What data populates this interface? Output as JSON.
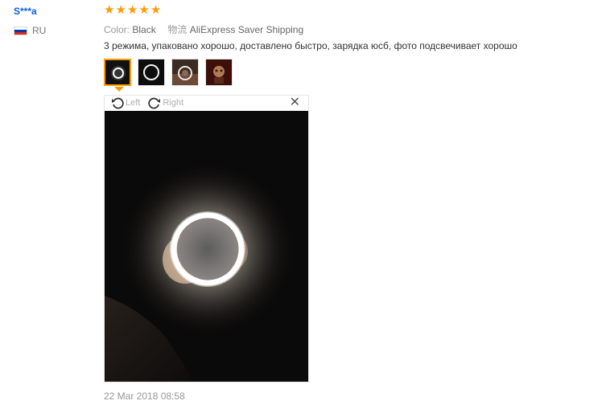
{
  "reviewer": {
    "name": "S***a",
    "country_code": "RU",
    "flag_colors": [
      "#ffffff",
      "#0039a6",
      "#d52b1e"
    ]
  },
  "rating": {
    "stars": 5,
    "max": 5,
    "color": "#ff9a00"
  },
  "meta": {
    "color_label": "Color:",
    "color_value": "Black",
    "shipping_label": "物流",
    "shipping_value": "AliExpress Saver Shipping"
  },
  "feedback_text": "3 режима, упаковано хорошо, доставлено быстро, зарядка юсб, фото подсвечивает хорошо",
  "thumbnails": [
    {
      "name": "thumb-ring-light-1",
      "active": true
    },
    {
      "name": "thumb-ring-light-2",
      "active": false
    },
    {
      "name": "thumb-ring-light-3",
      "active": false
    },
    {
      "name": "thumb-ring-light-4",
      "active": false
    }
  ],
  "viewer": {
    "rotate_left_label": "Left",
    "rotate_right_label": "Right",
    "close_glyph": "✕",
    "icons": [
      "rotate-left-icon",
      "rotate-right-icon",
      "close-icon"
    ]
  },
  "review_date": "22 Mar 2018 08:58"
}
